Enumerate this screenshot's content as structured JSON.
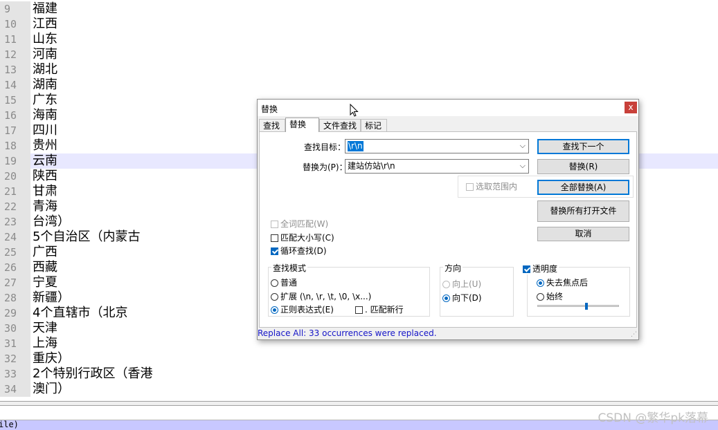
{
  "editor": {
    "lines": [
      {
        "num": "9",
        "text": "福建"
      },
      {
        "num": "10",
        "text": "江西"
      },
      {
        "num": "11",
        "text": "山东"
      },
      {
        "num": "12",
        "text": "河南"
      },
      {
        "num": "13",
        "text": "湖北"
      },
      {
        "num": "14",
        "text": "湖南"
      },
      {
        "num": "15",
        "text": "广东"
      },
      {
        "num": "16",
        "text": "海南"
      },
      {
        "num": "17",
        "text": "四川"
      },
      {
        "num": "18",
        "text": "贵州"
      },
      {
        "num": "19",
        "text": "云南"
      },
      {
        "num": "20",
        "text": "陕西"
      },
      {
        "num": "21",
        "text": "甘肃"
      },
      {
        "num": "22",
        "text": "青海"
      },
      {
        "num": "23",
        "text": "台湾）"
      },
      {
        "num": "24",
        "text": "5个自治区（内蒙古"
      },
      {
        "num": "25",
        "text": "广西"
      },
      {
        "num": "26",
        "text": "西藏"
      },
      {
        "num": "27",
        "text": "宁夏"
      },
      {
        "num": "28",
        "text": "新疆）"
      },
      {
        "num": "29",
        "text": "4个直辖市（北京"
      },
      {
        "num": "30",
        "text": "天津"
      },
      {
        "num": "31",
        "text": "上海"
      },
      {
        "num": "32",
        "text": "重庆）"
      },
      {
        "num": "33",
        "text": "2个特别行政区（香港"
      },
      {
        "num": "34",
        "text": "澳门）"
      }
    ],
    "current_line": "19"
  },
  "statusbar": {
    "text": "ile)"
  },
  "watermark": "CSDN @繁华pk落幕",
  "dialog": {
    "title": "替换",
    "close_label": "x",
    "tabs": [
      {
        "label": "查找",
        "active": false
      },
      {
        "label": "替换",
        "active": true
      },
      {
        "label": "文件查找",
        "active": false
      },
      {
        "label": "标记",
        "active": false
      }
    ],
    "find_label": "查找目标：",
    "find_value": "\\r\\n",
    "replace_label": "替换为(P)：",
    "replace_value": "建站仿站\\r\\n",
    "in_selection_label": "选取范围内",
    "buttons": {
      "find_next": "查找下一个",
      "replace": "替换(R)",
      "replace_all": "全部替换(A)",
      "replace_all_open": "替换所有打开文件",
      "cancel": "取消"
    },
    "options": {
      "whole_word": "全词匹配(W)",
      "match_case": "匹配大小写(C)",
      "wrap_around": "循环查找(D)"
    },
    "search_mode": {
      "title": "查找模式",
      "normal": "普通",
      "extended": "扩展 (\\n, \\r, \\t, \\0, \\x...)",
      "regex": "正则表达式(E)",
      "dot_newline": ". 匹配新行",
      "selected": "regex"
    },
    "direction": {
      "title": "方向",
      "up": "向上(U)",
      "down": "向下(D)",
      "selected": "down"
    },
    "transparency": {
      "title": "透明度",
      "on_lose_focus": "失去焦点后",
      "always": "始终",
      "enabled": true,
      "level": 0.6
    },
    "status_message": "Replace All: 33 occurrences were replaced."
  },
  "colors": {
    "current_line": "#e8e8ff",
    "status_message": "#1515c8",
    "accent": "#0078d7"
  }
}
